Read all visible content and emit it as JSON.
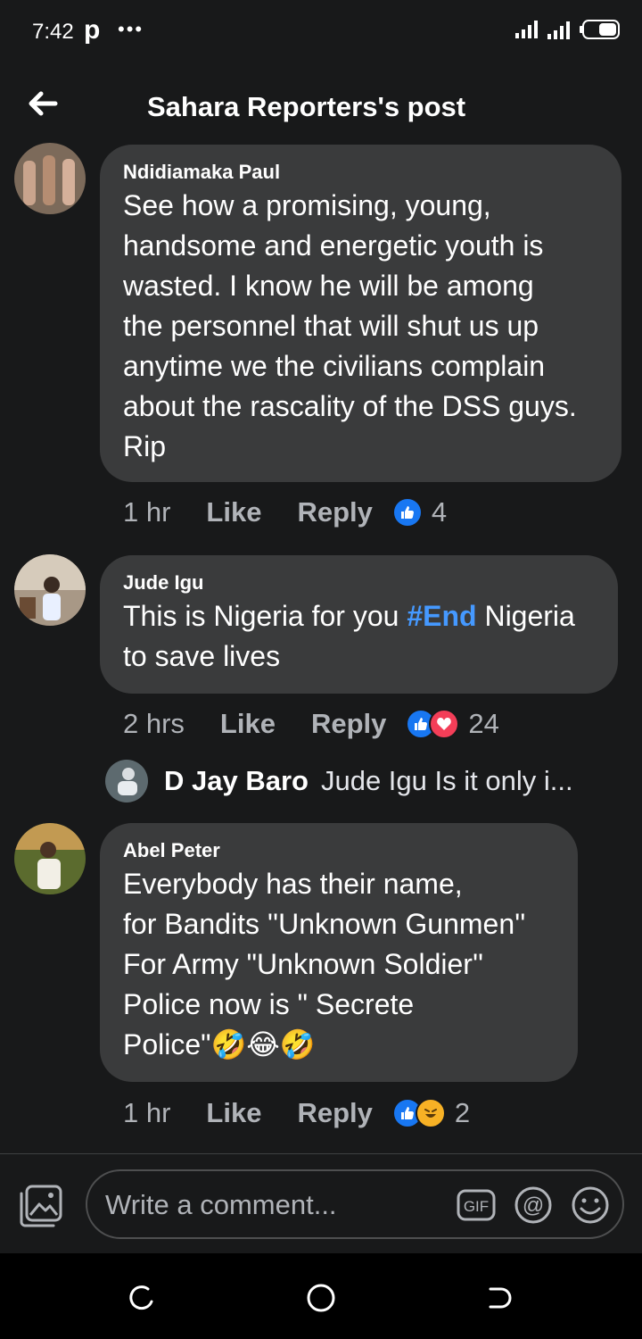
{
  "status": {
    "time": "7:42",
    "app_letter": "p",
    "dots": "•••"
  },
  "header": {
    "title": "Sahara Reporters's post"
  },
  "comments": [
    {
      "name": "Ndidiamaka Paul",
      "text": "See how a promising, young,\nhandsome and energetic youth is\nwasted.   I know he will be among\nthe personnel that will shut us up\nanytime we the civilians complain\nabout the rascality of the DSS guys.\nRip",
      "time": "1 hr",
      "like_label": "Like",
      "reply_label": "Reply",
      "reactions": [
        "like"
      ],
      "reaction_count": "4"
    },
    {
      "name": "Jude Igu",
      "text_before": "This is Nigeria for you ",
      "hashtag": "#End",
      "text_after": " Nigeria\nto save lives",
      "time": "2 hrs",
      "like_label": "Like",
      "reply_label": "Reply",
      "reactions": [
        "like",
        "love"
      ],
      "reaction_count": "24",
      "reply_preview": {
        "name": "D Jay Baro",
        "text": "Jude Igu  Is it only i..."
      }
    },
    {
      "name": "Abel Peter",
      "text": "Everybody has their name,\n for Bandits ''Unknown Gunmen''\nFor Army \"Unknown Soldier''\nPolice now is \" Secrete\nPolice\"🤣😂🤣",
      "time": "1 hr",
      "like_label": "Like",
      "reply_label": "Reply",
      "reactions": [
        "like",
        "haha"
      ],
      "reaction_count": "2"
    }
  ],
  "composer": {
    "placeholder": "Write a comment...",
    "gif_label": "GIF"
  },
  "colors": {
    "background": "#18191a",
    "bubble": "#3a3b3c",
    "hashtag": "#4599ff",
    "like": "#1877f2",
    "love": "#f33e58",
    "haha": "#f7b125"
  },
  "icons": [
    "back-arrow-icon",
    "photo-icon",
    "gif-icon",
    "mention-icon",
    "emoji-icon",
    "like-reaction-icon",
    "love-reaction-icon",
    "haha-reaction-icon"
  ]
}
